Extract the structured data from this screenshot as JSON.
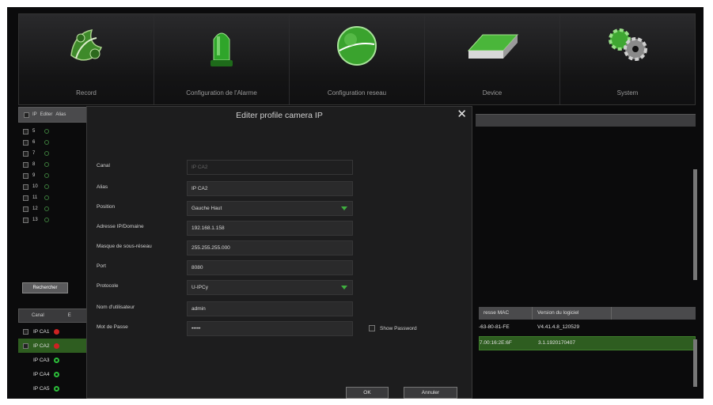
{
  "nav": [
    {
      "label": "Record",
      "icon": "clapper-icon"
    },
    {
      "label": "Configuration de l'Alarme",
      "icon": "alarm-light-icon"
    },
    {
      "label": "Configuration reseau",
      "icon": "network-globe-icon"
    },
    {
      "label": "Device",
      "icon": "hard-drive-icon"
    },
    {
      "label": "System",
      "icon": "gears-icon"
    }
  ],
  "left_list": {
    "header": [
      "IP",
      "Editer",
      "Alias"
    ],
    "rows": [
      "5",
      "6",
      "7",
      "8",
      "9",
      "10",
      "11",
      "12",
      "13"
    ],
    "search_label": "Rechercher"
  },
  "channels": {
    "header": [
      "Canal",
      "E"
    ],
    "rows": [
      {
        "name": "IP CA1",
        "status": "red"
      },
      {
        "name": "IP CA2",
        "status": "red"
      },
      {
        "name": "IP CA3",
        "status": "green"
      },
      {
        "name": "IP CA4",
        "status": "green"
      },
      {
        "name": "IP CA5",
        "status": "green"
      }
    ]
  },
  "mac_table": {
    "header": [
      "resse MAC",
      "Version du logiciel"
    ],
    "rows": [
      {
        "mac": "-63-80-81-FE",
        "version": "V4.41.4.8_120529"
      },
      {
        "mac": "7.00:16:2E:6F",
        "version": "3.1.1920170407"
      }
    ]
  },
  "dialog": {
    "title": "Editer profile camera IP",
    "fields": {
      "canal": {
        "label": "Canal",
        "value": "IP CA2"
      },
      "alias": {
        "label": "Alias",
        "value": "IP CA2"
      },
      "position": {
        "label": "Position",
        "value": "Gauche Haut"
      },
      "address": {
        "label": "Adresse IP/Domaine",
        "value": "192.168.1.158"
      },
      "mask": {
        "label": "Masque de sous-réseau",
        "value": "255.255.255.000"
      },
      "port": {
        "label": "Port",
        "value": "8080"
      },
      "protocol": {
        "label": "Protocole",
        "value": "U-IPCy"
      },
      "user": {
        "label": "Nom d'utilisateur",
        "value": "admin"
      },
      "password": {
        "label": "Mot de Passe",
        "value": "•••••"
      }
    },
    "show_password_label": "Show Password",
    "ok_label": "OK",
    "cancel_label": "Annuler"
  },
  "colors": {
    "selection": "#2e5d20",
    "accent_green": "#3fae3f",
    "status_red": "#c22222"
  }
}
